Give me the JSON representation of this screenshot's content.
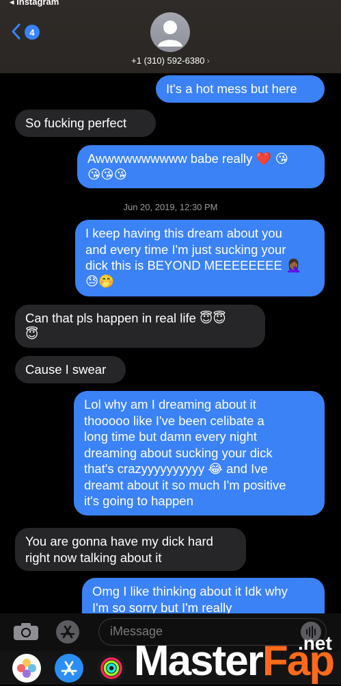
{
  "status_bar": {
    "back_app": "◂ Instagram"
  },
  "header": {
    "unread_count": "4",
    "contact_number": "+1 (310) 592-6380",
    "contact_chevron": "›"
  },
  "messages": [
    {
      "from": "me",
      "text": "It's a hot mess but here"
    },
    {
      "from": "them",
      "text": "So fucking perfect"
    },
    {
      "from": "me",
      "lines": [
        "Awwwwwwwwww babe really ❤️ 😘",
        "😘😘😘"
      ]
    },
    {
      "timestamp": "Jun 20, 2019, 12:30 PM"
    },
    {
      "from": "me",
      "lines": [
        "I keep having this dream about you",
        "and every time I'm just sucking your",
        "dick this is BEYOND MEEEEEEEE 🤦🏾‍♀️",
        "😓🤭"
      ]
    },
    {
      "from": "them",
      "lines": [
        "Can that pls happen in real life 😇😇",
        "😇"
      ]
    },
    {
      "from": "them",
      "text": "Cause I swear"
    },
    {
      "from": "me",
      "lines": [
        "Lol why am I dreaming about it",
        "thooooo like I've been celibate a",
        "long time but damn every night",
        "dreaming about sucking your dick",
        "that's crazyyyyyyyyyy 😂 and Ive",
        "dreamt about it so much I'm positive",
        "it's going to happen"
      ]
    },
    {
      "from": "them",
      "lines": [
        "You are gonna have my dick hard",
        "right now talking about it"
      ]
    },
    {
      "from": "me",
      "lines": [
        "Omg I like thinking about it Idk why",
        "I'm so sorry but I'm really"
      ]
    }
  ],
  "composer": {
    "placeholder": "iMessage"
  },
  "watermark": {
    "brand_left": "Master",
    "brand_right": "Fap",
    "suffix": ".net"
  },
  "colors": {
    "sent_bubble": "#3b82f6",
    "received_bubble": "#262628",
    "header_bg": "#2f2b28"
  }
}
